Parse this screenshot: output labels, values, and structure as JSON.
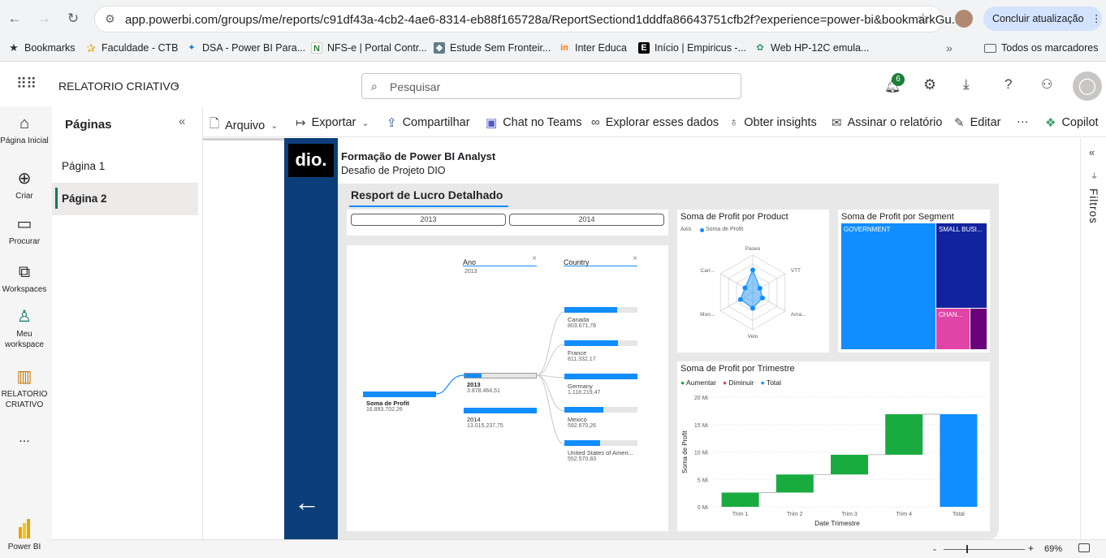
{
  "browser": {
    "url": "app.powerbi.com/groups/me/reports/c91df43a-4cb2-4ae6-8314-eb88f165728a/ReportSectiond1dddfa86643751cfb2f?experience=power-bi&bookmarkGu...",
    "update_label": "Concluir atualização",
    "bookmarks": [
      {
        "label": "Bookmarks",
        "icon": "star-icon"
      },
      {
        "label": "Faculdade - CTB",
        "icon": "star-outline-icon"
      },
      {
        "label": "DSA - Power BI Para...",
        "icon": "dsa-icon"
      },
      {
        "label": "NFS-e | Portal Contr...",
        "icon": "nfse-icon"
      },
      {
        "label": "Estude Sem Fronteir...",
        "icon": "estude-icon"
      },
      {
        "label": "Inter Educa",
        "icon": "inter-icon"
      },
      {
        "label": "Início | Empiricus -...",
        "icon": "empiricus-icon"
      },
      {
        "label": "Web HP-12C emula...",
        "icon": "hp-icon"
      }
    ],
    "all_bookmarks": "Todos os marcadores"
  },
  "header": {
    "report_name": "RELATORIO CRIATIVO",
    "search_placeholder": "Pesquisar",
    "notification_count": "6"
  },
  "rail": [
    {
      "label": "Página Inicial",
      "icon": "home-icon"
    },
    {
      "label": "Criar",
      "icon": "create-icon"
    },
    {
      "label": "Procurar",
      "icon": "folder-icon"
    },
    {
      "label": "Workspaces",
      "icon": "workspaces-icon"
    },
    {
      "label": "Meu workspace",
      "icon": "person-icon"
    },
    {
      "label": "RELATORIO CRIATIVO",
      "icon": "report-icon"
    }
  ],
  "rail_more": "...",
  "rail_brand": "Power BI",
  "pages": {
    "title": "Páginas",
    "items": [
      "Página 1",
      "Página 2"
    ],
    "selected": 1
  },
  "toolbar": {
    "arquivo": "Arquivo",
    "exportar": "Exportar",
    "compartilhar": "Compartilhar",
    "teams": "Chat no Teams",
    "explorar": "Explorar esses dados",
    "insights": "Obter insights",
    "assinar": "Assinar o relatório",
    "editar": "Editar",
    "more": "···",
    "copilot": "Copilot"
  },
  "filters_label": "Filtros",
  "report": {
    "logo": "dio.",
    "title": "Formação de Power BI Analyst",
    "subtitle": "Desafio de Projeto DIO",
    "page_heading": "Resport de Lucro Detalhado",
    "slicer": [
      "2013",
      "2014"
    ]
  },
  "decomp": {
    "col1": "Ano",
    "col1_value": "2013",
    "col2": "Country",
    "root_label": "Soma de Profit",
    "root_value": "16.893.702,26",
    "years": [
      {
        "label": "2013",
        "value": "3.878.464,51",
        "fill": 0.23
      },
      {
        "label": "2014",
        "value": "13.015.237,75",
        "fill": 1.0
      }
    ],
    "countries": [
      {
        "label": "Canada",
        "value": "803.671,78",
        "fill": 0.72
      },
      {
        "label": "France",
        "value": "811.332,17",
        "fill": 0.73
      },
      {
        "label": "Germany",
        "value": "1.118.219,47",
        "fill": 1.0
      },
      {
        "label": "Mexico",
        "value": "592.670,26",
        "fill": 0.53
      },
      {
        "label": "United States of Ameri...",
        "value": "552.570,83",
        "fill": 0.49
      }
    ]
  },
  "radar": {
    "title": "Soma de Profit por Product",
    "legend_axis": "Axis",
    "legend_series": "Soma de Profit",
    "axes": [
      "Paseo",
      "VTT",
      "Ama...",
      "Velo",
      "Mon...",
      "Carr..."
    ],
    "values": [
      0.6,
      0.22,
      0.3,
      0.42,
      0.38,
      0.24
    ],
    "color": "#118dff"
  },
  "treemap": {
    "title": "Soma de Profit por Segment",
    "segments": [
      {
        "label": "GOVERNMENT",
        "color": "#118dff"
      },
      {
        "label": "SMALL BUSI...",
        "color": "#12239e"
      },
      {
        "label": "CHAN...",
        "color": "#e044a7"
      },
      {
        "label": "",
        "color": "#6b007b"
      }
    ]
  },
  "chart_data": {
    "type": "bar",
    "title": "Soma de Profit por Trimestre",
    "xlabel": "Date Trimestre",
    "ylabel": "Soma de Profit",
    "categories": [
      "Trim 1",
      "Trim 2",
      "Trim 3",
      "Trim 4",
      "Total"
    ],
    "waterfall": [
      {
        "start": 0,
        "end": 2.6
      },
      {
        "start": 2.6,
        "end": 5.9
      },
      {
        "start": 5.9,
        "end": 9.5
      },
      {
        "start": 9.5,
        "end": 16.9
      },
      {
        "start": 0,
        "end": 16.9
      }
    ],
    "legend": [
      "Aumentar",
      "Diminuir",
      "Total"
    ],
    "colors": {
      "Aumentar": "#1aab40",
      "Diminuir": "#d64554",
      "Total": "#118dff"
    },
    "yticks": [
      "0 Mi",
      "5 Mi",
      "10 Mi",
      "15 Mi",
      "20 Mi"
    ],
    "ylim": [
      0,
      20
    ]
  },
  "status": {
    "zoom": "69%",
    "minus": "-",
    "plus": "+"
  }
}
